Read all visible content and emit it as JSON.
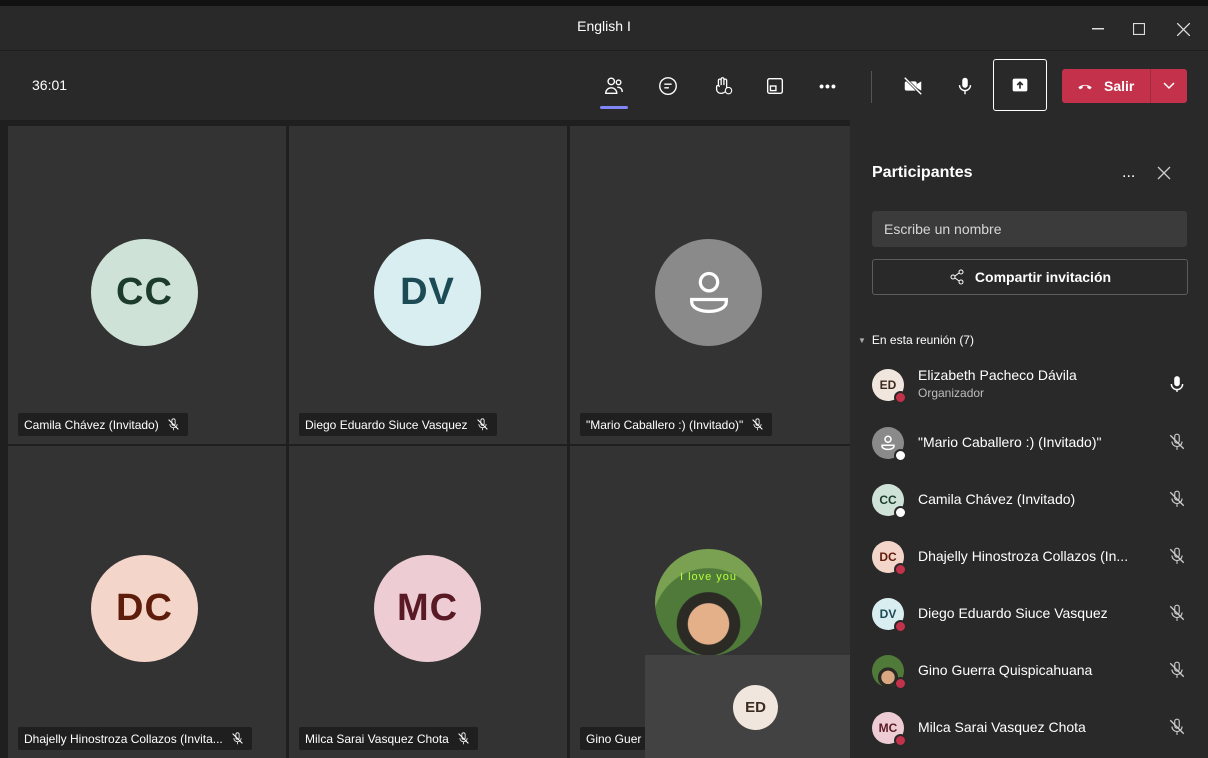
{
  "window": {
    "title": "English I",
    "controls": [
      "minimize",
      "maximize",
      "close"
    ]
  },
  "toolbar": {
    "timer": "36:01",
    "buttons": [
      "people-icon",
      "chat-icon",
      "raise-hand-icon",
      "breakout-rooms-icon",
      "more-icon",
      "camera-off-icon",
      "mic-icon",
      "share-screen-icon"
    ],
    "leave_label": "Salir",
    "more_glyph": "•••"
  },
  "colors": {
    "accent": "#7f85f5",
    "leave": "#c4314b",
    "busy": "#c4314b",
    "offline": "#ffffff"
  },
  "tiles": [
    {
      "initials": "CC",
      "name": "Camila Chávez (Invitado)",
      "muted": true
    },
    {
      "initials": "DV",
      "name": "Diego Eduardo Siuce Vasquez",
      "muted": true
    },
    {
      "initials": "",
      "name": "\"Mario Caballero :) (Invitado)\"",
      "muted": true
    },
    {
      "initials": "DC",
      "name": "Dhajelly Hinostroza Collazos (Invita...",
      "muted": true
    },
    {
      "initials": "MC",
      "name": "Milca Sarai Vasquez Chota",
      "muted": true
    },
    {
      "initials": "",
      "name": "Gino Guer",
      "photo_caption": "I love you",
      "muted": true
    }
  ],
  "self_view": {
    "initials": "ED"
  },
  "panel": {
    "title": "Participantes",
    "more_glyph": "...",
    "search_placeholder": "Escribe un nombre",
    "invite_label": "Compartir invitación",
    "section_label": "En esta reunión (7)",
    "participants": [
      {
        "initials": "ED",
        "name": "Elizabeth Pacheco Dávila",
        "role": "Organizador",
        "mic": "on",
        "status": "busy"
      },
      {
        "initials": "",
        "name": "\"Mario Caballero :) (Invitado)\"",
        "role": "",
        "mic": "muted",
        "status": "offline"
      },
      {
        "initials": "CC",
        "name": "Camila Chávez (Invitado)",
        "role": "",
        "mic": "muted",
        "status": "offline"
      },
      {
        "initials": "DC",
        "name": "Dhajelly Hinostroza Collazos (In...",
        "role": "",
        "mic": "muted",
        "status": "busy"
      },
      {
        "initials": "DV",
        "name": "Diego Eduardo Siuce Vasquez",
        "role": "",
        "mic": "muted",
        "status": "busy"
      },
      {
        "initials": "",
        "name": "Gino Guerra Quispicahuana",
        "role": "",
        "mic": "muted",
        "status": "busy"
      },
      {
        "initials": "MC",
        "name": "Milca Sarai Vasquez Chota",
        "role": "",
        "mic": "muted",
        "status": "busy"
      }
    ]
  }
}
